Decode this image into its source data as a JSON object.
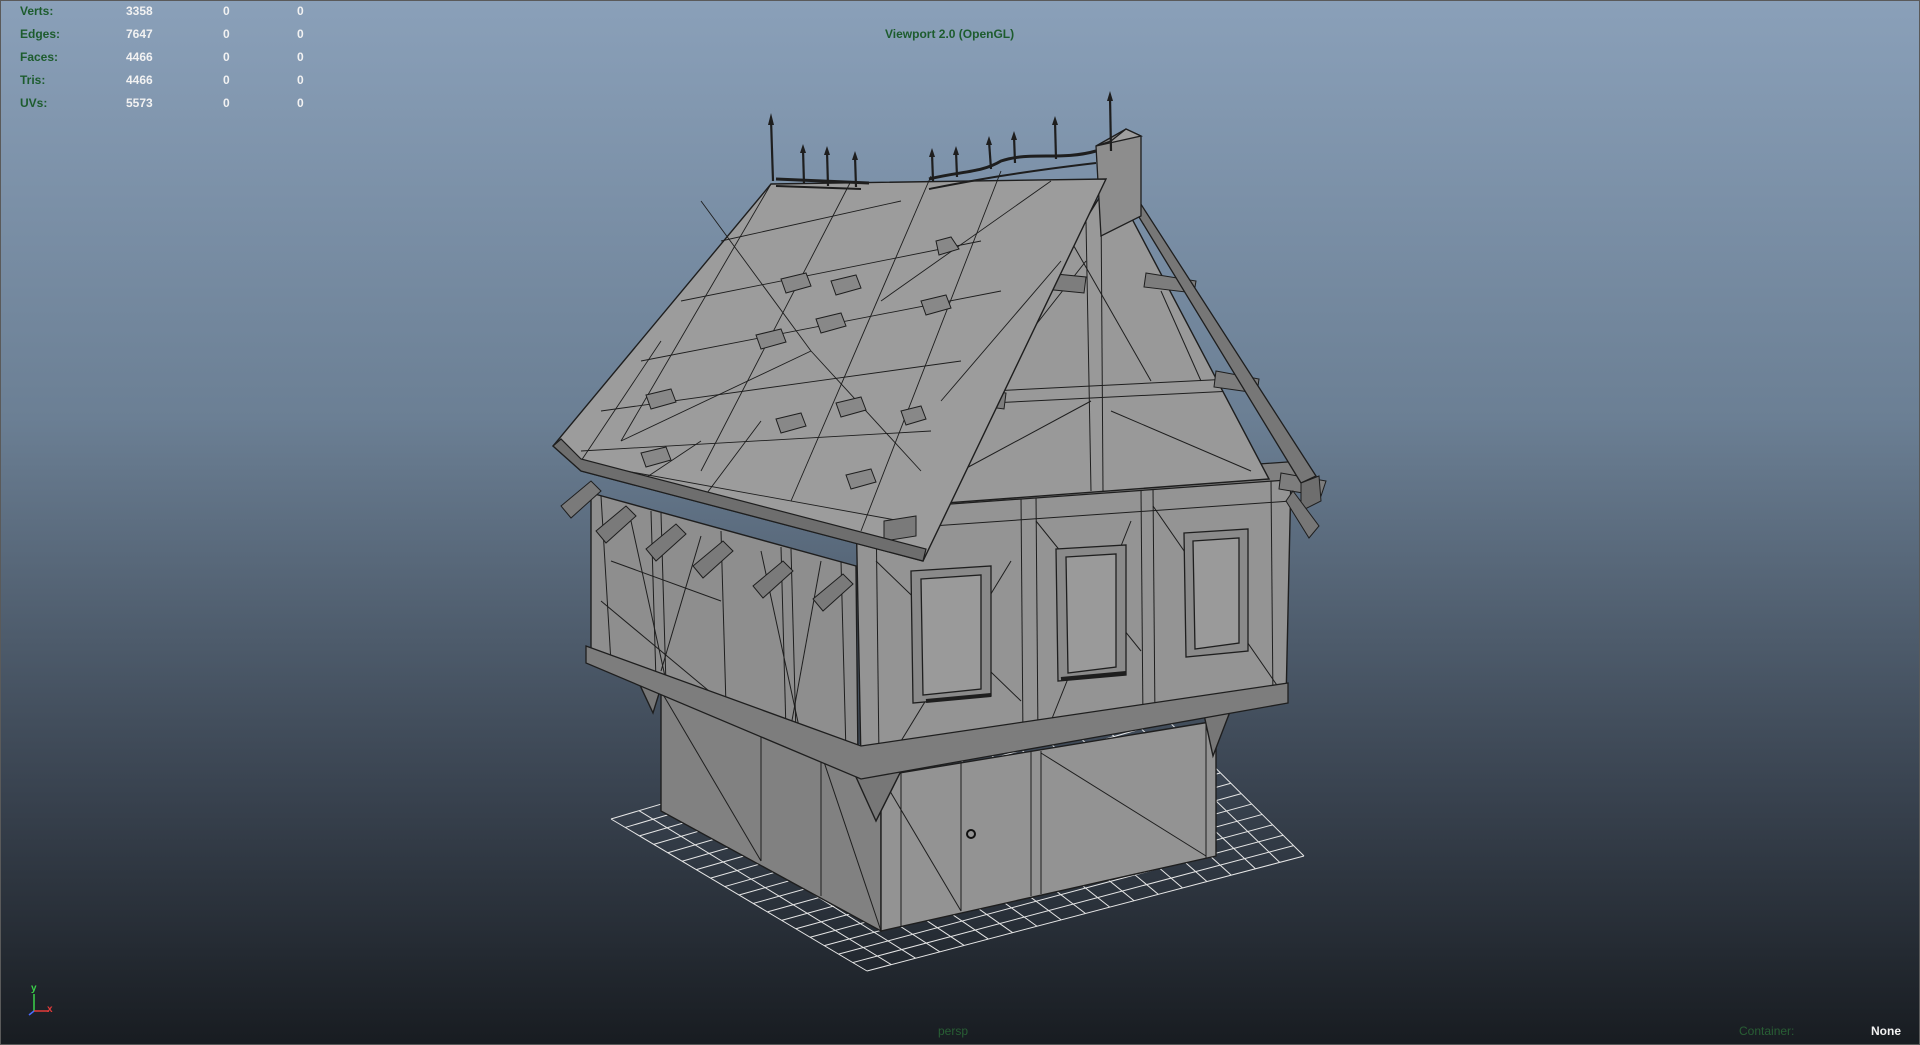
{
  "renderer": "Viewport 2.0 (OpenGL)",
  "heads_up": {
    "rows": [
      {
        "label": "Verts:",
        "values": [
          "3358",
          "0",
          "0"
        ]
      },
      {
        "label": "Edges:",
        "values": [
          "7647",
          "0",
          "0"
        ]
      },
      {
        "label": "Faces:",
        "values": [
          "4466",
          "0",
          "0"
        ]
      },
      {
        "label": "Tris:",
        "values": [
          "4466",
          "0",
          "0"
        ]
      },
      {
        "label": "UVs:",
        "values": [
          "5573",
          "0",
          "0"
        ]
      }
    ]
  },
  "camera": "persp",
  "container_label": "Container:",
  "selection_value": "None",
  "axis": {
    "y": "y",
    "x": "x",
    "z": "z"
  },
  "colors": {
    "hud_label": "#1d5c2e",
    "hud_value": "#f2f2f2",
    "mesh_fill": "#8c8c8c",
    "wire": "#1e1e1e",
    "grid": "#e6e6e6"
  },
  "icons": [
    "axis-gizmo-icon",
    "door-knob-icon"
  ]
}
